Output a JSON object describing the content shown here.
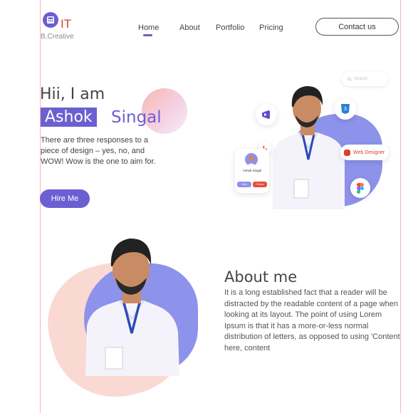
{
  "brand": {
    "logo_text": "IT",
    "tagline": "B,Creative"
  },
  "nav": {
    "items": [
      "Home",
      "About",
      "Portfolio",
      "Pricing"
    ],
    "active": "Home",
    "contact_label": "Contact us"
  },
  "hero": {
    "greeting": "Hii, I am",
    "first_name": "Ashok",
    "last_name": "Singal",
    "intro": "There are three responses to a piece of design – yes, no, and WOW! Wow is the one to aim for.",
    "hire_label": "Hire Me",
    "search_placeholder": "Search",
    "profile_card": {
      "name": "Ashok Singal",
      "like_label": "Like",
      "follow_label": "Follow"
    },
    "badge_label": "Web Designer"
  },
  "about": {
    "title": "About me",
    "text": "It is a long established fact that a reader will be distracted by the readable content of a page when looking at its layout. The point of using Lorem Ipsum is that it has a more-or-less normal distribution of letters, as opposed to using 'Content here, content"
  },
  "colors": {
    "accent": "#6b5fd1",
    "logo_red": "#d9402b",
    "blob_blue": "#8d92ea",
    "blob_pink": "#fbd9d3"
  }
}
